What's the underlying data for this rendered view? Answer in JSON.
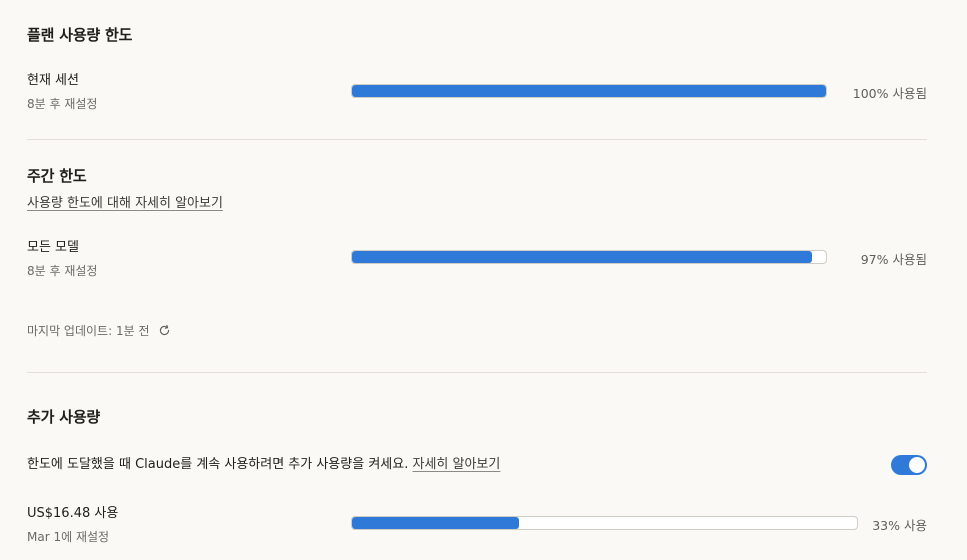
{
  "plan_limits": {
    "title": "플랜 사용량 한도",
    "current_session": {
      "label": "현재 세션",
      "reset": "8분 후 재설정",
      "percent": 100,
      "percent_text": "100% 사용됨"
    }
  },
  "weekly_limits": {
    "title": "주간 한도",
    "learn_more": "사용량 한도에 대해 자세히 알아보기",
    "all_models": {
      "label": "모든 모델",
      "reset": "8분 후 재설정",
      "percent": 97,
      "percent_text": "97% 사용됨"
    },
    "last_updated": "마지막 업데이트: 1분 전",
    "refresh_icon": "refresh-icon"
  },
  "extra_usage": {
    "title": "추가 사용량",
    "description": "한도에 도달했을 때 Claude를 계속 사용하려면 추가 사용량을 켜세요.",
    "learn_more": "자세히 알아보기",
    "toggle_on": true,
    "spend": {
      "label": "US$16.48 사용",
      "reset": "Mar 1에 재설정",
      "percent": 33,
      "percent_text": "33% 사용"
    }
  },
  "colors": {
    "accent": "#2f7ad9",
    "background": "#faf9f5",
    "divider": "#e2e0d9"
  }
}
